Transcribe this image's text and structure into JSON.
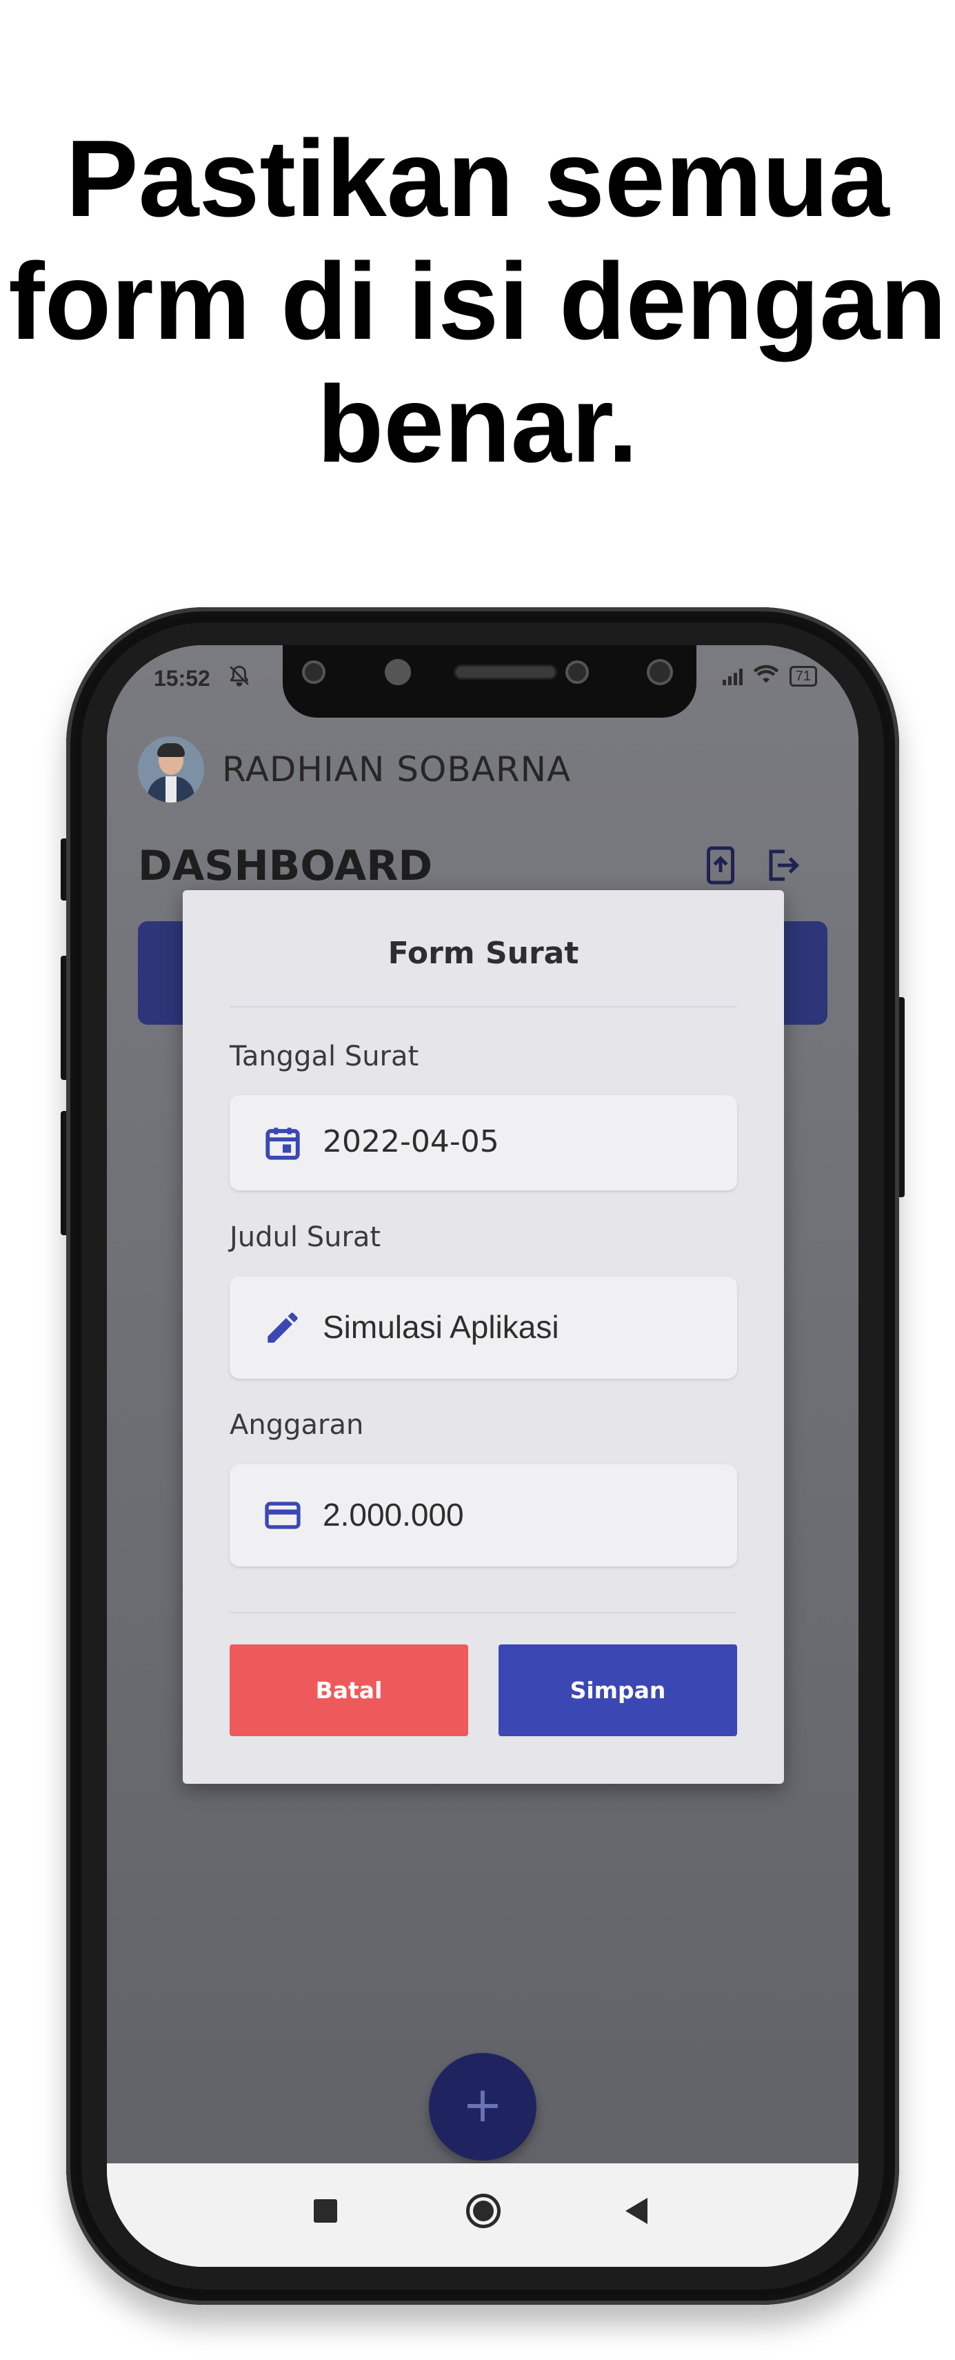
{
  "headline": {
    "line1": "Pastikan semua",
    "line2": "form di isi dengan",
    "line3": "benar."
  },
  "status_bar": {
    "time": "15:52",
    "battery": "71"
  },
  "app": {
    "user_name": "RADHIAN SOBARNA",
    "dashboard_title": "DASHBOARD"
  },
  "modal": {
    "title": "Form Surat",
    "fields": [
      {
        "label": "Tanggal Surat",
        "value": "2022-04-05",
        "icon": "calendar-icon"
      },
      {
        "label": "Judul Surat",
        "value": "Simulasi Aplikasi",
        "icon": "pencil-icon"
      },
      {
        "label": "Anggaran",
        "value": "2.000.000",
        "icon": "credit-card-icon"
      }
    ],
    "cancel_label": "Batal",
    "save_label": "Simpan"
  },
  "fab": {
    "label": "+"
  },
  "colors": {
    "primary": "#3b47b3",
    "danger": "#ee5a5c",
    "dashboard_card": "#2e3679",
    "modal_bg": "#e6e6ea",
    "field_bg": "#f0f0f2"
  }
}
